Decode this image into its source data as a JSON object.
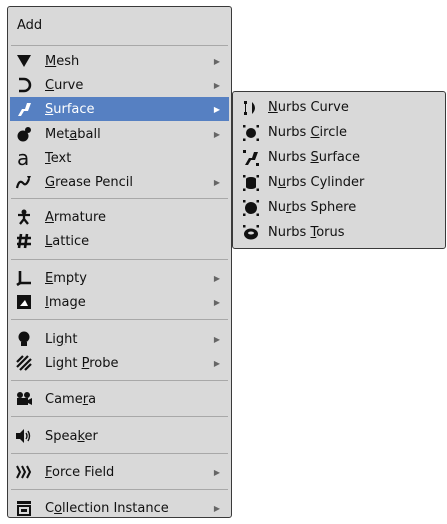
{
  "menu": {
    "title": "Add",
    "items": [
      {
        "label": "Mesh",
        "ul": "M",
        "rest": "esh",
        "icon": "mesh-icon",
        "submenu": true
      },
      {
        "label": "Curve",
        "ul": "C",
        "rest": "urve",
        "icon": "curve-icon",
        "submenu": true
      },
      {
        "label": "Surface",
        "ul": "S",
        "rest": "urface",
        "icon": "surface-icon",
        "submenu": true,
        "highlighted": true
      },
      {
        "label": "Metaball",
        "pre": "Met",
        "ul": "a",
        "rest": "ball",
        "icon": "metaball-icon",
        "submenu": true
      },
      {
        "label": "Text",
        "ul": "T",
        "rest": "ext",
        "icon": "text-icon",
        "submenu": false
      },
      {
        "label": "Grease Pencil",
        "ul": "G",
        "rest": "rease Pencil",
        "icon": "grease-pencil-icon",
        "submenu": true
      },
      {
        "label": "Armature",
        "ul": "A",
        "rest": "rmature",
        "icon": "armature-icon",
        "submenu": false
      },
      {
        "label": "Lattice",
        "ul": "L",
        "rest": "attice",
        "icon": "lattice-icon",
        "submenu": false
      },
      {
        "label": "Empty",
        "ul": "E",
        "rest": "mpty",
        "icon": "empty-icon",
        "submenu": true
      },
      {
        "label": "Image",
        "ul": "I",
        "rest": "mage",
        "icon": "image-icon",
        "submenu": true
      },
      {
        "label": "Light",
        "pre": "Li",
        "ul": "g",
        "rest": "ht",
        "icon": "light-icon",
        "submenu": true
      },
      {
        "label": "Light Probe",
        "pre": "Light ",
        "ul": "P",
        "rest": "robe",
        "icon": "light-probe-icon",
        "submenu": true
      },
      {
        "label": "Camera",
        "pre": "Came",
        "ul": "r",
        "rest": "a",
        "icon": "camera-icon",
        "submenu": false
      },
      {
        "label": "Speaker",
        "pre": "Spea",
        "ul": "k",
        "rest": "er",
        "icon": "speaker-icon",
        "submenu": false
      },
      {
        "label": "Force Field",
        "ul": "F",
        "rest": "orce Field",
        "icon": "force-field-icon",
        "submenu": true
      },
      {
        "label": "Collection Instance",
        "pre": "C",
        "ul": "o",
        "rest": "llection Instance",
        "icon": "collection-instance-icon",
        "submenu": true
      }
    ]
  },
  "submenu": {
    "items": [
      {
        "label": "Nurbs Curve",
        "ul": "N",
        "rest": "urbs Curve",
        "icon": "nurbs-curve-icon"
      },
      {
        "label": "Nurbs Circle",
        "pre": "Nurbs ",
        "ul": "C",
        "rest": "ircle",
        "icon": "nurbs-circle-icon"
      },
      {
        "label": "Nurbs Surface",
        "pre": "Nurbs ",
        "ul": "S",
        "rest": "urface",
        "icon": "nurbs-surface-icon"
      },
      {
        "label": "Nurbs Cylinder",
        "pre": "N",
        "ul": "u",
        "rest": "rbs Cylinder",
        "icon": "nurbs-cylinder-icon"
      },
      {
        "label": "Nurbs Sphere",
        "pre": "Nu",
        "ul": "r",
        "rest": "bs Sphere",
        "icon": "nurbs-sphere-icon"
      },
      {
        "label": "Nurbs Torus",
        "pre": "Nurbs ",
        "ul": "T",
        "rest": "orus",
        "icon": "nurbs-torus-icon"
      }
    ]
  },
  "colors": {
    "highlight": "#5680c2",
    "menu_bg": "#d9d9d9"
  }
}
